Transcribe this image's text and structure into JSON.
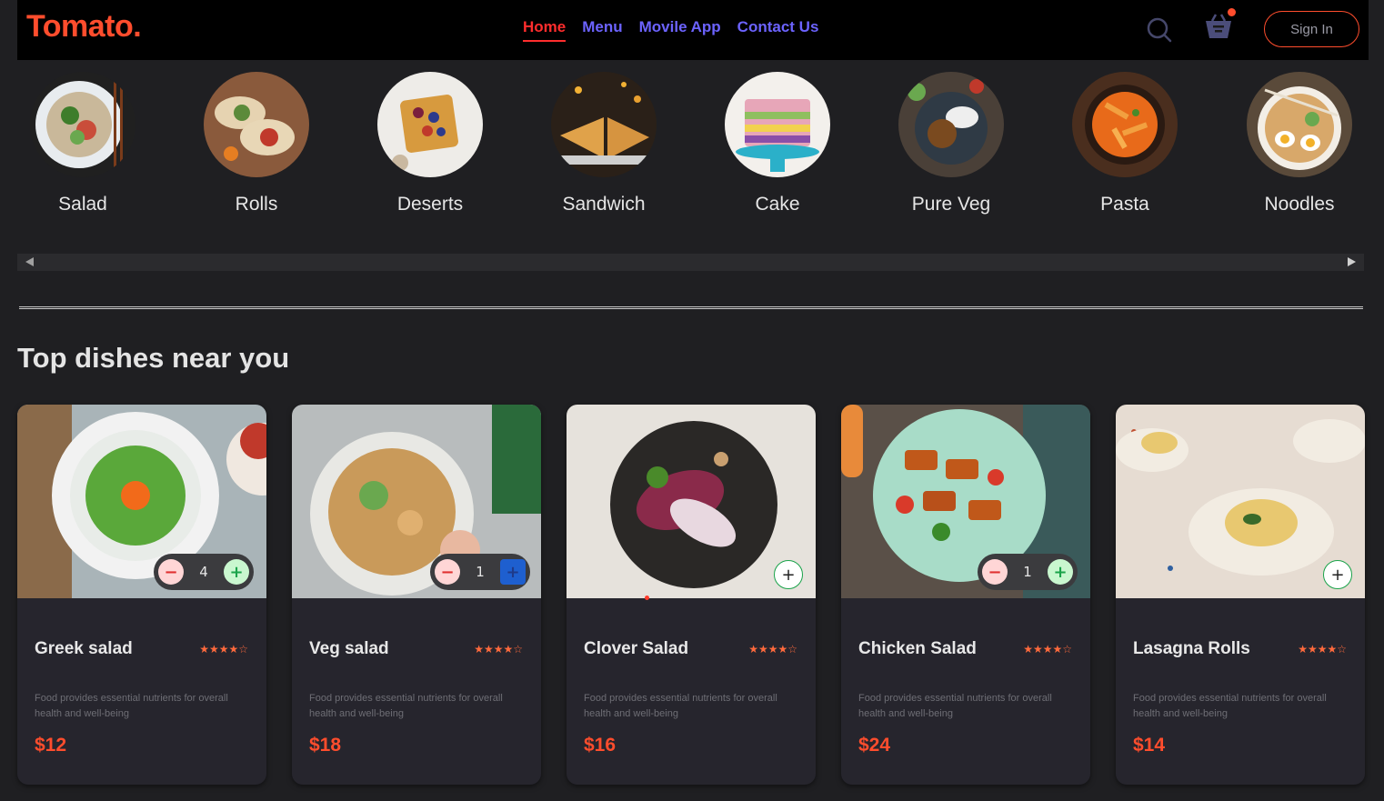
{
  "nav": {
    "logo": "Tomato.",
    "links": [
      {
        "label": "Home",
        "active": true
      },
      {
        "label": "Menu"
      },
      {
        "label": "Movile App"
      },
      {
        "label": "Contact Us"
      }
    ],
    "search_icon": "search-icon",
    "basket_icon": "basket-icon",
    "signin_label": "Sign In"
  },
  "categories": [
    {
      "label": "Salad"
    },
    {
      "label": "Rolls"
    },
    {
      "label": "Deserts"
    },
    {
      "label": "Sandwich"
    },
    {
      "label": "Cake"
    },
    {
      "label": "Pure Veg"
    },
    {
      "label": "Pasta"
    },
    {
      "label": "Noodles"
    }
  ],
  "section_title": "Top dishes near you",
  "dishes": [
    {
      "name": "Greek salad",
      "rating": "★★★★☆",
      "desc": "Food provides essential nutrients for overall health and well-being",
      "price": "$12",
      "count": "4"
    },
    {
      "name": "Veg salad",
      "rating": "★★★★☆",
      "desc": "Food provides essential nutrients for overall health and well-being",
      "price": "$18",
      "count": "1"
    },
    {
      "name": "Clover Salad",
      "rating": "★★★★☆",
      "desc": "Food provides essential nutrients for overall health and well-being",
      "price": "$16",
      "count": null
    },
    {
      "name": "Chicken Salad",
      "rating": "★★★★☆",
      "desc": "Food provides essential nutrients for overall health and well-being",
      "price": "$24",
      "count": "1"
    },
    {
      "name": "Lasagna Rolls",
      "rating": "★★★★☆",
      "desc": "Food provides essential nutrients for overall health and well-being",
      "price": "$14",
      "count": null
    }
  ],
  "colors": {
    "accent": "#ff4d2d",
    "nav_link": "#6c63ff",
    "background": "#1f1f22",
    "card": "#26252d"
  }
}
